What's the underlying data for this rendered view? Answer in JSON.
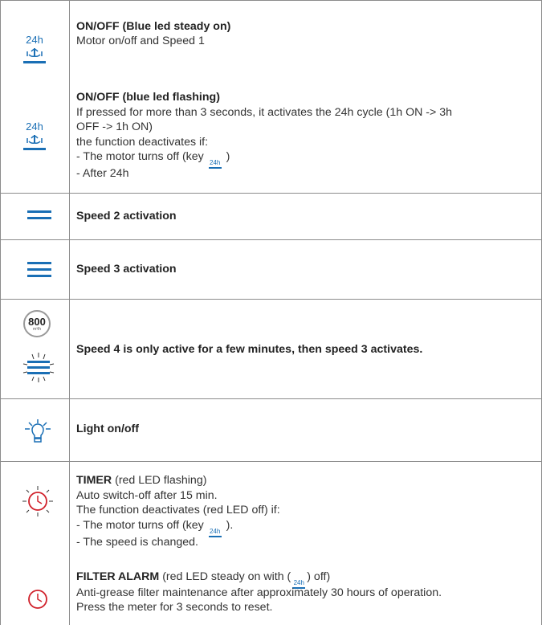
{
  "row1": {
    "title": "ON/OFF (Blue led steady on)",
    "desc": "Motor on/off and Speed 1"
  },
  "row2": {
    "title": "ON/OFF (blue led flashing)",
    "lines": [
      "If pressed for more than 3 seconds, it activates the 24h cycle (1h ON -> 3h",
      "OFF -> 1h ON)",
      "the function deactivates if:"
    ],
    "motor_off_prefix": "- The motor turns off (key",
    "motor_off_suffix": ")",
    "after": "- After 24h"
  },
  "row3": {
    "label": "Speed 2 activation"
  },
  "row4": {
    "label": "Speed 3 activation"
  },
  "row5": {
    "badge": "800",
    "badge_unit": "m³/h",
    "label": "Speed 4 is only active for a few minutes, then speed 3 activates."
  },
  "row6": {
    "label": "Light on/off"
  },
  "row7": {
    "title": "TIMER",
    "title_note": "(red LED flashing)",
    "l1": "Auto switch-off after 15 min.",
    "l2": "The function deactivates (red LED off) if:",
    "l3_prefix": "- The motor turns off (key",
    "l3_suffix": ").",
    "l4": "- The speed is changed."
  },
  "row8": {
    "title": "FILTER ALARM",
    "title_note_prefix": "(red LED steady on with (",
    "title_note_suffix": ") off)",
    "l1": "Anti-grease filter maintenance after approximately 30 hours of operation.",
    "l2": "Press the meter for 3 seconds to reset."
  },
  "icon_text": "24h",
  "colors": {
    "blue": "#1a6fb5",
    "red": "#d0202a",
    "border": "#8c8c8c"
  }
}
